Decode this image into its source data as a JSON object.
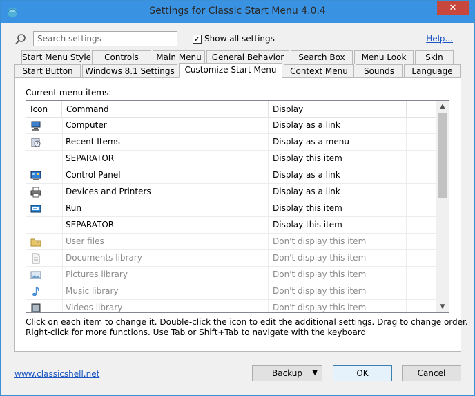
{
  "window": {
    "title": "Settings for Classic Start Menu 4.0.4",
    "close_label": "✕"
  },
  "search": {
    "placeholder": "Search settings",
    "value": ""
  },
  "show_all": {
    "label": "Show all settings",
    "checked": true
  },
  "help": {
    "label": "Help..."
  },
  "tabs_row1": [
    "Start Menu Style",
    "Controls",
    "Main Menu",
    "General Behavior",
    "Search Box",
    "Menu Look",
    "Skin"
  ],
  "tabs_row2": [
    "Start Button",
    "Windows 8.1 Settings",
    "Customize Start Menu",
    "Context Menu",
    "Sounds",
    "Language"
  ],
  "active_tab": "Customize Start Menu",
  "list": {
    "label": "Current menu items:",
    "headers": [
      "Icon",
      "Command",
      "Display"
    ],
    "rows": [
      {
        "icon": "computer-icon",
        "command": "Computer",
        "display": "Display as a link",
        "dim": false
      },
      {
        "icon": "recent-items-icon",
        "command": "Recent Items",
        "display": "Display as a menu",
        "dim": false
      },
      {
        "icon": "",
        "command": "SEPARATOR",
        "display": "Display this item",
        "dim": false
      },
      {
        "icon": "control-panel-icon",
        "command": "Control Panel",
        "display": "Display as a link",
        "dim": false
      },
      {
        "icon": "printer-icon",
        "command": "Devices and Printers",
        "display": "Display as a link",
        "dim": false
      },
      {
        "icon": "run-icon",
        "command": "Run",
        "display": "Display this item",
        "dim": false
      },
      {
        "icon": "",
        "command": "SEPARATOR",
        "display": "Display this item",
        "dim": false
      },
      {
        "icon": "user-files-icon",
        "command": "User files",
        "display": "Don't display this item",
        "dim": true
      },
      {
        "icon": "document-icon",
        "command": "Documents library",
        "display": "Don't display this item",
        "dim": true
      },
      {
        "icon": "picture-icon",
        "command": "Pictures library",
        "display": "Don't display this item",
        "dim": true
      },
      {
        "icon": "music-icon",
        "command": "Music library",
        "display": "Don't display this item",
        "dim": true
      },
      {
        "icon": "video-icon",
        "command": "Videos library",
        "display": "Don't display this item",
        "dim": true
      }
    ]
  },
  "hints": {
    "line1": "Click on each item to change it. Double-click the icon to edit the additional settings. Drag to change order.",
    "line2": "Right-click for more functions. Use Tab or Shift+Tab to navigate with the keyboard"
  },
  "footer": {
    "website": "www.classicshell.net",
    "backup": "Backup",
    "ok": "OK",
    "cancel": "Cancel"
  },
  "colors": {
    "titlebar": "#3a93e2",
    "close": "#c7473d",
    "link": "#1a55c2"
  }
}
